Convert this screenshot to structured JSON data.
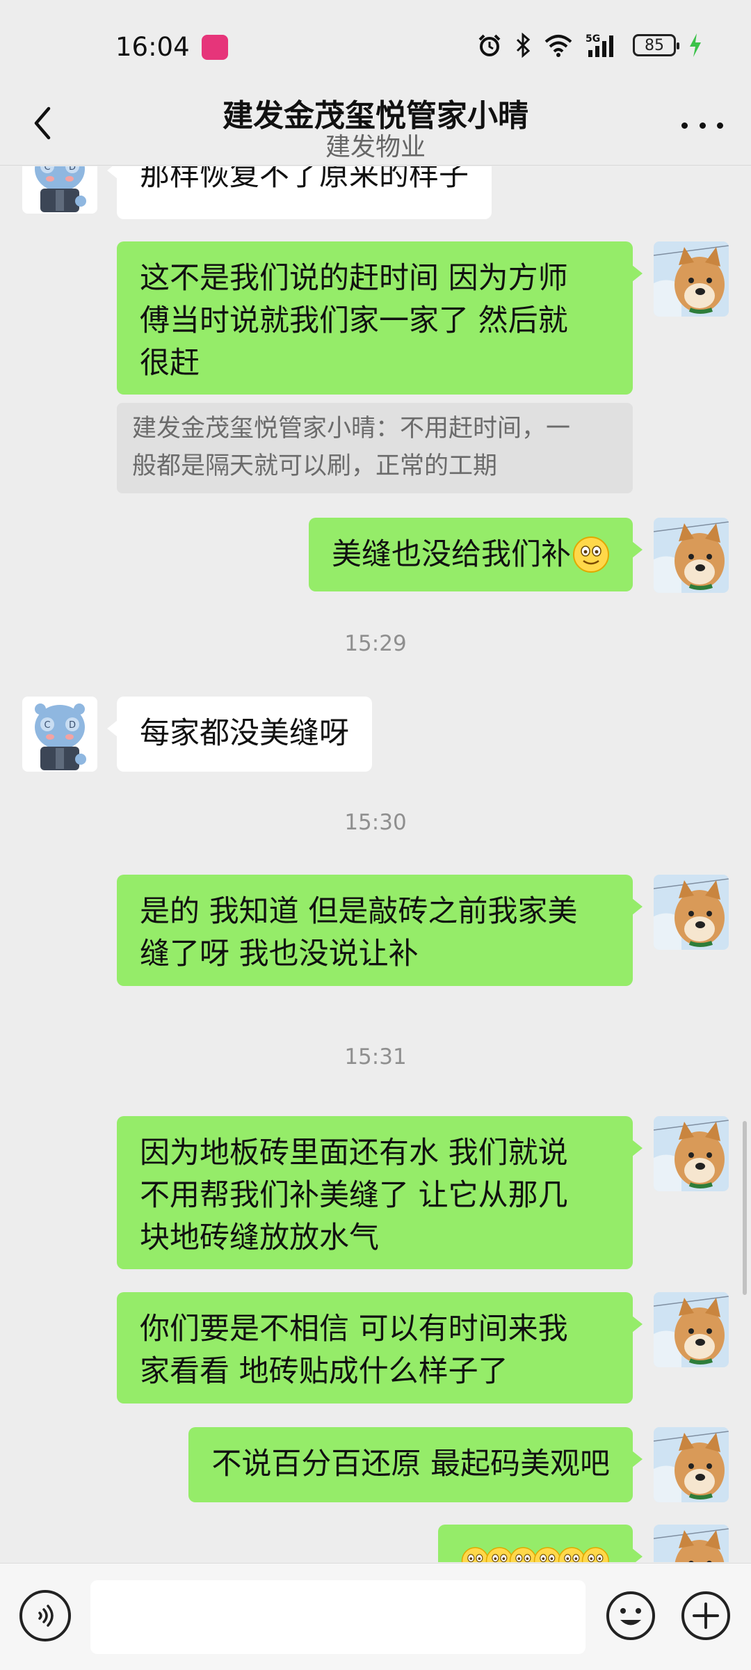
{
  "status_bar": {
    "time": "16:04",
    "battery": "85",
    "network": "5G",
    "icons": [
      "alarm-icon",
      "bluetooth-icon",
      "wifi-icon",
      "signal-icon",
      "battery-icon",
      "charging-icon"
    ]
  },
  "header": {
    "title": "建发金茂玺悦管家小晴",
    "subtitle": "建发物业",
    "back_icon": "chevron-left-icon",
    "more_icon": "more-dots-icon"
  },
  "messages": [
    {
      "side": "left",
      "text": "那样恢复不了原来的样子"
    },
    {
      "side": "right",
      "lines": [
        "这不是我们说的赶时间  因为方师",
        "傅当时说就我们家一家了  然后就",
        "很赶"
      ]
    },
    {
      "quote_lines": [
        "建发金茂玺悦管家小晴：不用赶时间，一",
        "般都是隔天就可以刷，正常的工期"
      ]
    },
    {
      "side": "right",
      "text": "美缝也没给我们补",
      "emoji": "grin-emoji"
    },
    {
      "timestamp": "15:29"
    },
    {
      "side": "left",
      "text": "每家都没美缝呀"
    },
    {
      "timestamp": "15:30"
    },
    {
      "side": "right",
      "lines": [
        "是的  我知道  但是敲砖之前我家美",
        "缝了呀  我也没说让补"
      ]
    },
    {
      "timestamp": "15:31"
    },
    {
      "side": "right",
      "lines": [
        "因为地板砖里面还有水  我们就说",
        "不用帮我们补美缝了  让它从那几",
        "块地砖缝放放水气"
      ]
    },
    {
      "side": "right",
      "lines": [
        "你们要是不相信  可以有时间来我",
        "家看看  地砖贴成什么样子了"
      ]
    },
    {
      "side": "right",
      "text": "不说百分百还原  最起码美观吧"
    },
    {
      "side": "right",
      "emoji_count": 6,
      "emoji": "grin-emoji"
    }
  ],
  "input_bar": {
    "voice_icon": "voice-icon",
    "input_value": "",
    "emoji_icon": "emoji-icon",
    "plus_icon": "plus-icon"
  },
  "colors": {
    "background": "#ededed",
    "own_bubble": "#95ec69",
    "other_bubble": "#ffffff",
    "quote_bg": "#e0e0e0",
    "timestamp": "#8f8f8f",
    "app_badge": "#e6357a"
  }
}
